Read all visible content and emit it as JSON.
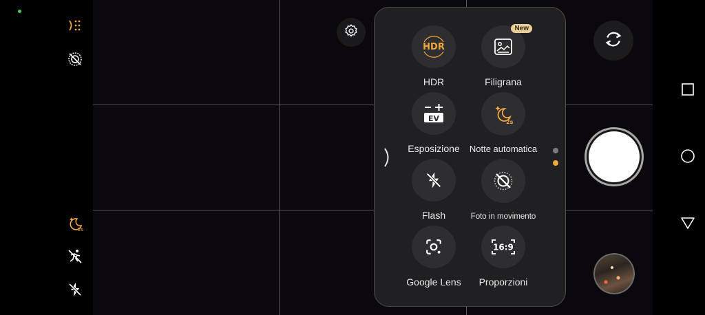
{
  "left_rail": {
    "icons": [
      "filter-grid-icon",
      "motion-photo-off-icon",
      "auto-night-icon",
      "motion-off-icon",
      "flash-off-icon"
    ],
    "accent_color": "#f2a93b"
  },
  "quick_panel": {
    "tiles": [
      {
        "label": "HDR",
        "icon": "hdr-icon",
        "icon_text": "HDR"
      },
      {
        "label": "Filigrana",
        "icon": "watermark-icon",
        "badge": "New"
      },
      {
        "label": "Esposizione",
        "icon": "exposure-icon",
        "icon_text": "EV"
      },
      {
        "label": "Notte automatica",
        "icon": "auto-night-icon",
        "icon_text": "2s"
      },
      {
        "label": "Flash",
        "icon": "flash-off-icon"
      },
      {
        "label": "Foto in movimento",
        "icon": "motion-photo-off-icon"
      },
      {
        "label": "Google Lens",
        "icon": "google-lens-icon"
      },
      {
        "label": "Proporzioni",
        "icon": "aspect-ratio-icon",
        "icon_text": "16:9"
      }
    ],
    "pages": {
      "count": 2,
      "active": 2
    }
  },
  "colors": {
    "accent": "#f2a93b",
    "panel_bg": "#202022",
    "viewfinder_bg": "#0b080d"
  },
  "nav": [
    "recents-icon",
    "home-icon",
    "back-icon"
  ]
}
